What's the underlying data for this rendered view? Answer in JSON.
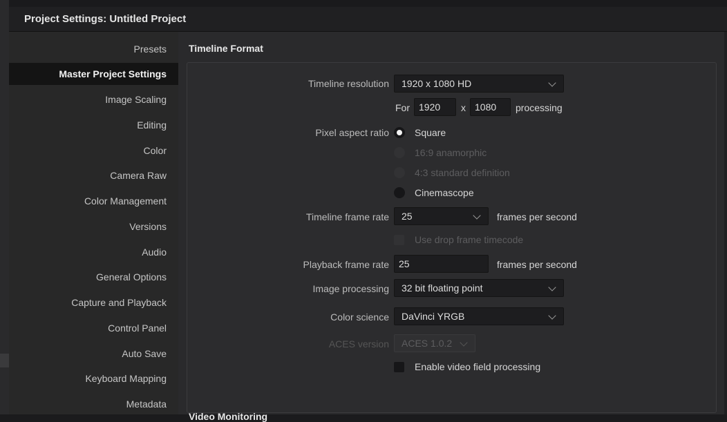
{
  "window": {
    "title": "Project Settings:  Untitled Project"
  },
  "sidebar": {
    "items": [
      {
        "label": "Presets"
      },
      {
        "label": "Master Project Settings"
      },
      {
        "label": "Image Scaling"
      },
      {
        "label": "Editing"
      },
      {
        "label": "Color"
      },
      {
        "label": "Camera Raw"
      },
      {
        "label": "Color Management"
      },
      {
        "label": "Versions"
      },
      {
        "label": "Audio"
      },
      {
        "label": "General Options"
      },
      {
        "label": "Capture and Playback"
      },
      {
        "label": "Control Panel"
      },
      {
        "label": "Auto Save"
      },
      {
        "label": "Keyboard Mapping"
      },
      {
        "label": "Metadata"
      }
    ],
    "active_index": 1
  },
  "timeline_format": {
    "section_title": "Timeline Format",
    "resolution": {
      "label": "Timeline resolution",
      "value": "1920 x 1080 HD"
    },
    "processing": {
      "prefix": "For",
      "width": "1920",
      "separator": "x",
      "height": "1080",
      "suffix": "processing"
    },
    "pixel_aspect": {
      "label": "Pixel aspect ratio",
      "options": [
        {
          "label": "Square",
          "state": "checked"
        },
        {
          "label": "16:9 anamorphic",
          "state": "disabled"
        },
        {
          "label": "4:3 standard definition",
          "state": "disabled"
        },
        {
          "label": "Cinemascope",
          "state": "unchecked"
        }
      ]
    },
    "frame_rate": {
      "label": "Timeline frame rate",
      "value": "25",
      "suffix": "frames per second"
    },
    "drop_frame": {
      "label": "Use drop frame timecode",
      "checked": false,
      "disabled": true
    },
    "playback_rate": {
      "label": "Playback frame rate",
      "value": "25",
      "suffix": "frames per second"
    },
    "image_processing": {
      "label": "Image processing",
      "value": "32 bit floating point"
    },
    "color_science": {
      "label": "Color science",
      "value": "DaVinci YRGB"
    },
    "aces_version": {
      "label": "ACES version",
      "value": "ACES 1.0.2",
      "disabled": true
    },
    "video_field": {
      "label": "Enable video field processing",
      "checked": false
    }
  },
  "video_monitoring": {
    "section_title": "Video Monitoring"
  }
}
